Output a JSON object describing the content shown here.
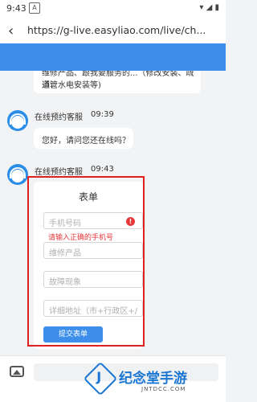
{
  "status_bar": {
    "time": "9:43",
    "notification": "A",
    "right_icons": "▾ ◢ ▮"
  },
  "browser": {
    "url": "https://g-live.easyliao.com/live/ch..."
  },
  "messages": [
    {
      "text_clip": "维修产品、跟我要服务的...（修改安装、疏通管",
      "text_line2": "道、水电安装等)"
    },
    {
      "sender": "在线预约客服",
      "time": "09:39",
      "text": "您好，请问您还在线吗？"
    },
    {
      "sender": "在线预约客服",
      "time": "09:43"
    }
  ],
  "form": {
    "title": "表单",
    "phone_placeholder": "手机号码",
    "phone_error": "请输入正确的手机号",
    "product_placeholder": "维修产品",
    "fault_placeholder": "故障现象",
    "address_placeholder": "详细地址（市+行政区+/",
    "submit_label": "提交表单"
  },
  "watermark": {
    "text": "纪念堂手游",
    "sub": "JNTDCC.COM"
  },
  "colors": {
    "primary": "#3d8eea",
    "error": "#e5383b",
    "highlight": "#e02020"
  }
}
